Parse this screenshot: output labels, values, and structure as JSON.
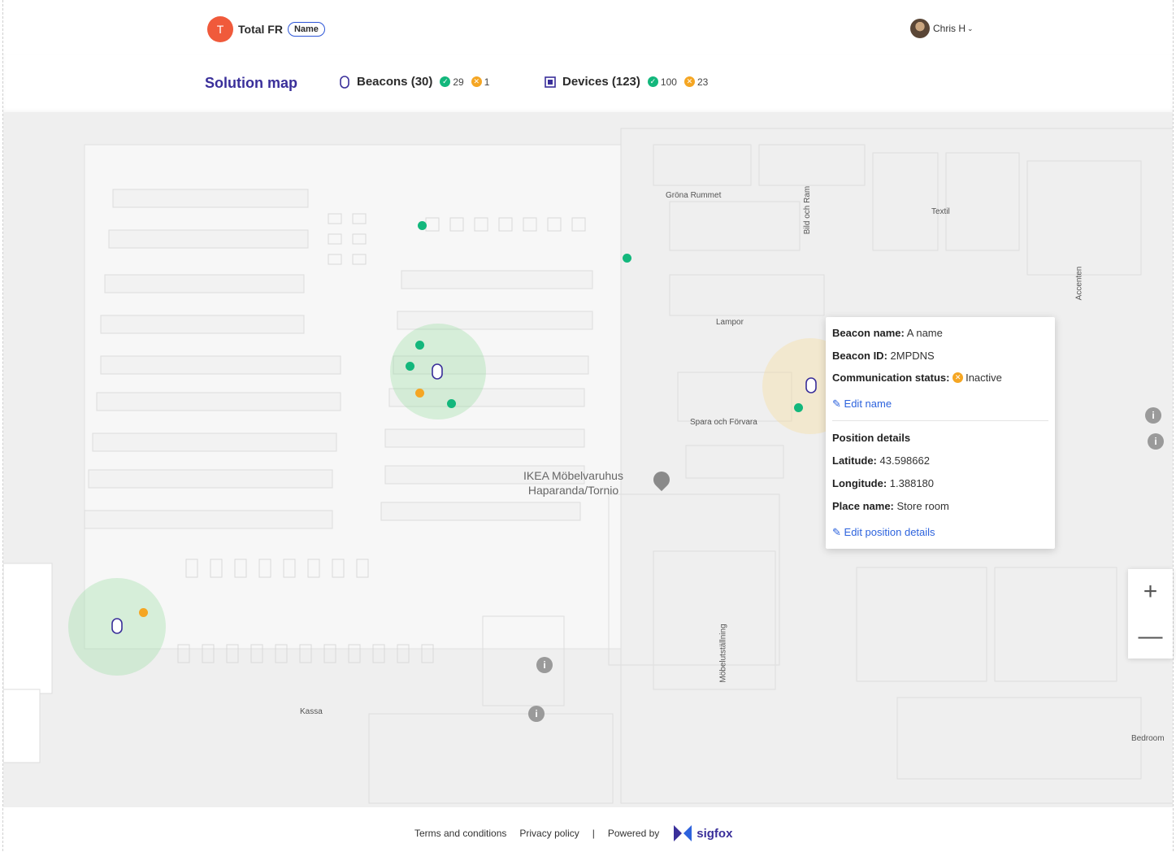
{
  "header": {
    "org_initial": "T",
    "org_name": "Total FR",
    "org_badge": "Name",
    "user_name": "Chris H"
  },
  "subheader": {
    "title": "Solution map",
    "beacons": {
      "label": "Beacons (30)",
      "ok": "29",
      "warn": "1"
    },
    "devices": {
      "label": "Devices (123)",
      "ok": "100",
      "warn": "23"
    }
  },
  "map": {
    "labels": {
      "grona": "Gröna Rummet",
      "bild": "Bild och Ram",
      "textil": "Textil",
      "accenten": "Accenten",
      "lampor": "Lampor",
      "spara": "Spara och Förvara",
      "poi_line1": "IKEA Möbelvaruhus",
      "poi_line2": "Haparanda/Tornio",
      "mobel": "Möbelutställning",
      "kassa": "Kassa",
      "bedroom": "Bedroom"
    }
  },
  "popup": {
    "beacon_name_label": "Beacon name:",
    "beacon_name": "A name",
    "beacon_id_label": "Beacon ID:",
    "beacon_id": "2MPDNS",
    "comm_label": "Communication status:",
    "comm_value": "Inactive",
    "edit_name": "Edit name",
    "position_title": "Position details",
    "lat_label": "Latitude:",
    "lat": "43.598662",
    "lon_label": "Longitude:",
    "lon": "1.388180",
    "place_label": "Place name:",
    "place": "Store room",
    "edit_position": "Edit position details"
  },
  "zoom": {
    "in": "+",
    "out": "—"
  },
  "footer": {
    "terms": "Terms and conditions",
    "privacy": "Privacy policy",
    "divider": "|",
    "powered": "Powered by",
    "brand": "sigfox"
  },
  "colors": {
    "primary": "#3a2f9a",
    "ok": "#13b77c",
    "warn": "#f5a623",
    "link": "#2d63dd",
    "org": "#f05a3b"
  }
}
